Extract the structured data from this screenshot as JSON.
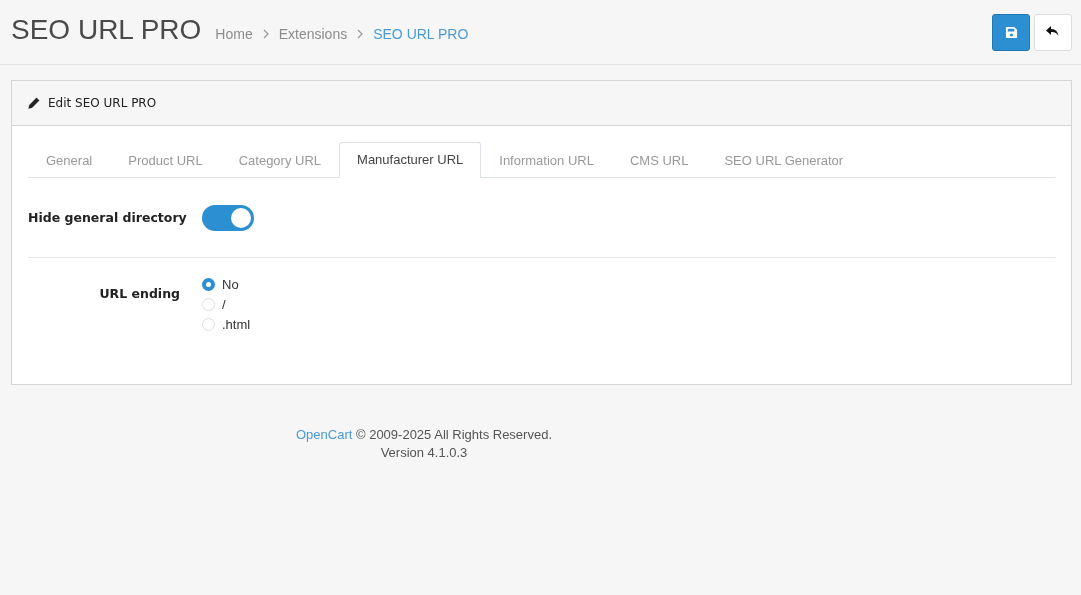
{
  "page_title": "SEO URL PRO",
  "breadcrumb": [
    {
      "label": "Home",
      "current": false
    },
    {
      "label": "Extensions",
      "current": false
    },
    {
      "label": "SEO URL PRO",
      "current": true
    }
  ],
  "panel": {
    "title": "Edit SEO URL PRO"
  },
  "tabs": [
    {
      "label": "General",
      "selected": false
    },
    {
      "label": "Product URL",
      "selected": false
    },
    {
      "label": "Category URL",
      "selected": false
    },
    {
      "label": "Manufacturer URL",
      "selected": true
    },
    {
      "label": "Information URL",
      "selected": false
    },
    {
      "label": "CMS URL",
      "selected": false
    },
    {
      "label": "SEO URL Generator",
      "selected": false
    }
  ],
  "fields": [
    {
      "kind": "toggle",
      "label": "Hide general directory",
      "on": true
    },
    {
      "kind": "radio",
      "label": "URL ending",
      "options": [
        {
          "label": "No",
          "selected": true
        },
        {
          "label": "/",
          "selected": false
        },
        {
          "label": ".html",
          "selected": false
        }
      ]
    }
  ],
  "footer": {
    "link": "OpenCart",
    "copyright": " © 2009-2025 All Rights Reserved.",
    "version": "Version 4.1.0.3"
  }
}
